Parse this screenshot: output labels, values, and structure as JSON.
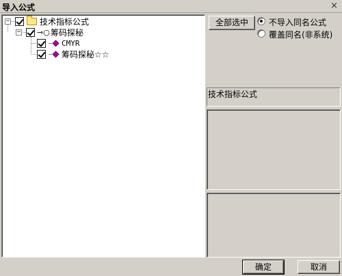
{
  "window": {
    "title": "导入公式",
    "close_glyph": "×"
  },
  "tree": {
    "root": {
      "label": "技术指标公式",
      "expander": "−",
      "checked": true
    },
    "child": {
      "label": "筹码探秘",
      "expander": "−",
      "checked": true
    },
    "leaves": [
      {
        "label": "CMYR",
        "checked": true
      },
      {
        "label": "筹码探秘☆☆",
        "checked": true
      }
    ]
  },
  "options": {
    "select_all_label": "全部选中",
    "radio_skip_label": "不导入同名公式",
    "radio_overwrite_label": "覆盖同名(非系统)",
    "selected": "skip"
  },
  "info": {
    "category_text": "技术指标公式"
  },
  "footer": {
    "ok_label": "确定",
    "cancel_label": "取消"
  },
  "colors": {
    "face": "#d4d0c8",
    "leaf_icon": "#b000b0",
    "folder": "#ffe680"
  }
}
